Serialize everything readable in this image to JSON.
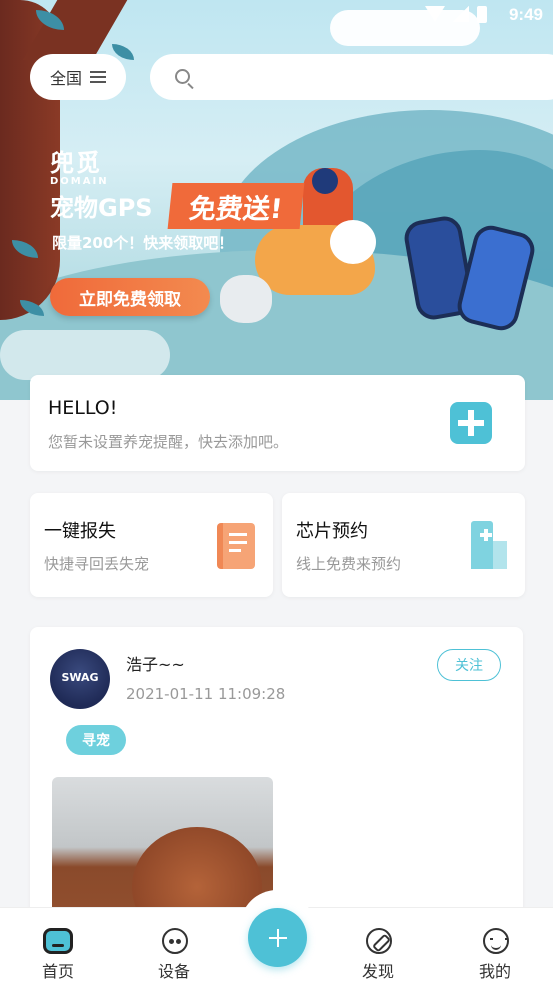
{
  "status_bar": {
    "time": "9:49"
  },
  "header": {
    "region_label": "全国",
    "search_placeholder": ""
  },
  "banner": {
    "brand_name": "兜觅",
    "brand_sub": "DOMAIN",
    "title": "宠物GPS",
    "badge": "免费送!",
    "subtitle": "限量200个！快来领取吧！",
    "cta": "立即免费领取"
  },
  "reminder_card": {
    "title": "HELLO!",
    "description": "您暂未设置养宠提醒，快去添加吧。"
  },
  "features": [
    {
      "title": "一键报失",
      "description": "快捷寻回丢失宠"
    },
    {
      "title": "芯片预约",
      "description": "线上免费来预约"
    }
  ],
  "post": {
    "avatar_text": "SWAG",
    "username": "浩子~~",
    "timestamp": "2021-01-11 11:09:28",
    "follow_label": "关注",
    "tag": "寻宠"
  },
  "bottom_nav": [
    {
      "label": "首页",
      "icon": "home-icon",
      "active": true
    },
    {
      "label": "设备",
      "icon": "device-icon"
    },
    {
      "label": "发现",
      "icon": "compass-icon"
    },
    {
      "label": "我的",
      "icon": "smiley-icon"
    }
  ],
  "colors": {
    "accent": "#4ec1d6",
    "promo": "#f06a3a"
  }
}
